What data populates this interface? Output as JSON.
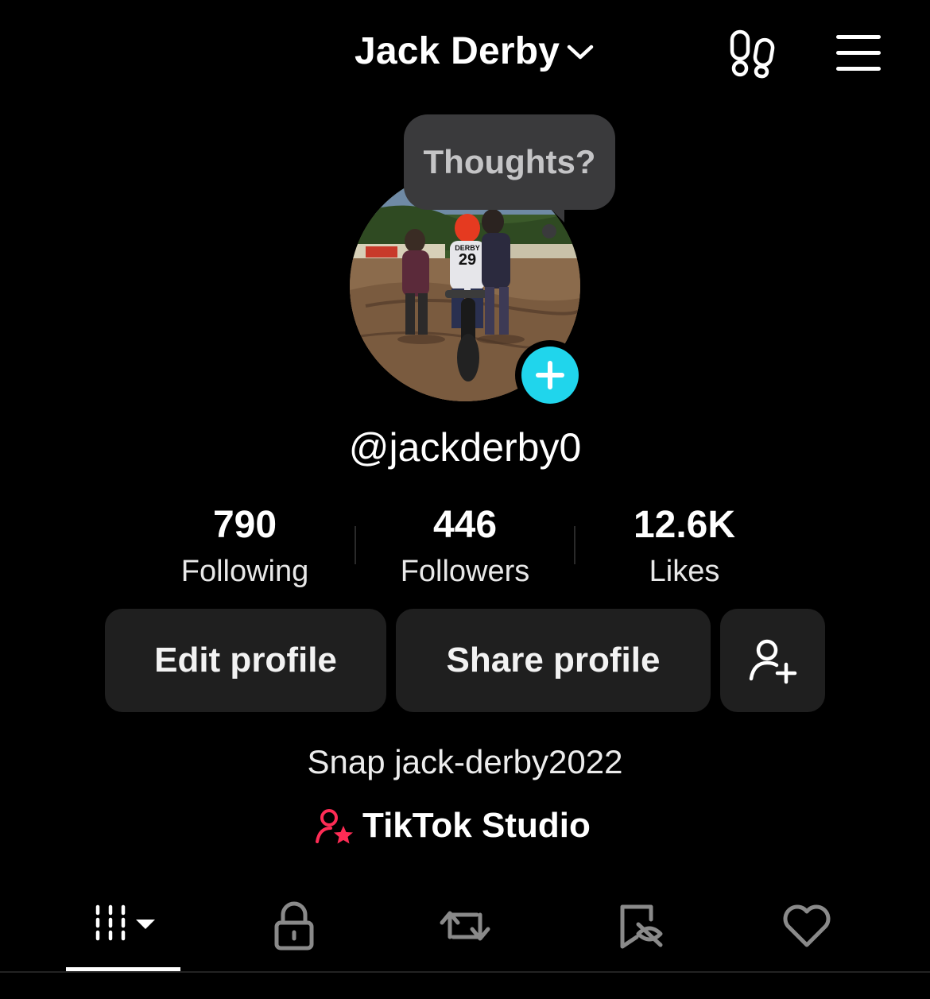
{
  "header": {
    "title": "Jack Derby",
    "icons": {
      "dropdown": "chevron-down-icon",
      "visitors": "footprints-icon",
      "menu": "hamburger-menu-icon"
    }
  },
  "profile": {
    "bubble_text": "Thoughts?",
    "username": "@jackderby0",
    "avatar_jersey": "29",
    "avatar_name_on_jersey": "DERBY"
  },
  "stats": [
    {
      "value": "790",
      "label": "Following"
    },
    {
      "value": "446",
      "label": "Followers"
    },
    {
      "value": "12.6K",
      "label": "Likes"
    }
  ],
  "actions": {
    "edit_label": "Edit profile",
    "share_label": "Share profile",
    "add_friend_icon": "add-friend-icon"
  },
  "bio": "Snap jack-derby2022",
  "studio": {
    "label": "TikTok Studio",
    "icon_color": "#fe2c55"
  },
  "tabs": [
    {
      "icon": "videos-grid-icon",
      "active": true
    },
    {
      "icon": "lock-icon",
      "active": false
    },
    {
      "icon": "repost-icon",
      "active": false
    },
    {
      "icon": "hidden-favorites-icon",
      "active": false
    },
    {
      "icon": "heart-icon",
      "active": false
    }
  ],
  "colors": {
    "background": "#000000",
    "accent_cyan": "#20d5ec",
    "accent_pink": "#fe2c55",
    "button_bg": "#1f1f1f",
    "bubble_bg": "#3a3a3c"
  }
}
